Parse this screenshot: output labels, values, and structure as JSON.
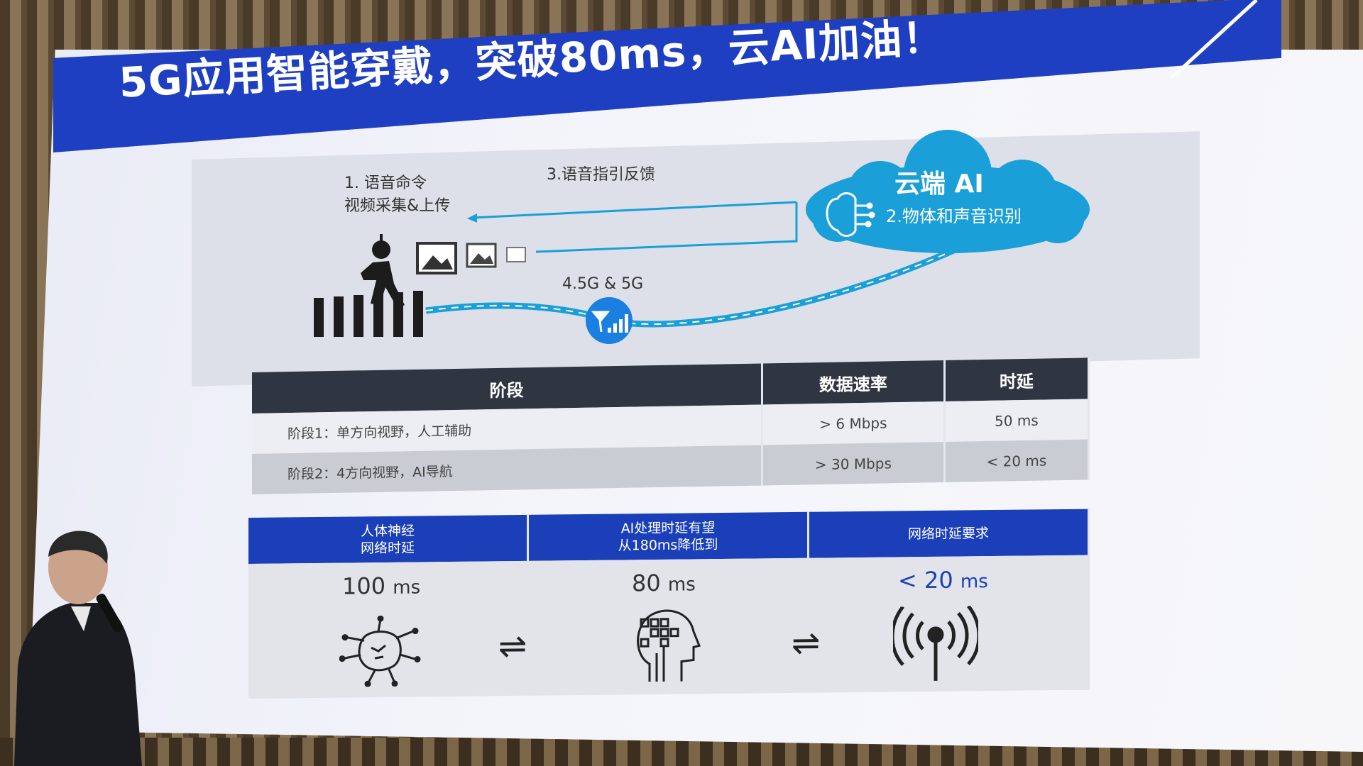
{
  "title": "5G应用智能穿戴，突破80ms，云AI加油！",
  "diagram": {
    "step1_line1": "1. 语音命令",
    "step1_line2": "视频采集&上传",
    "step3": "3.语音指引反馈",
    "network": "4.5G & 5G",
    "cloud_title": "云端 AI",
    "step2": "2.物体和声音识别"
  },
  "table": {
    "headers": [
      "阶段",
      "数据速率",
      "时延"
    ],
    "rows": [
      [
        "阶段1：单方向视野，人工辅助",
        "> 6 Mbps",
        "50 ms"
      ],
      [
        "阶段2：4方向视野，AI导航",
        "> 30 Mbps",
        "< 20 ms"
      ]
    ]
  },
  "latency": {
    "headers": [
      {
        "line1": "人体神经",
        "line2": "网络时延"
      },
      {
        "line1": "AI处理时延有望",
        "line2": "从180ms降低到"
      },
      {
        "line1": "网络时延要求",
        "line2": ""
      }
    ],
    "values": [
      {
        "num": "100",
        "unit": "ms"
      },
      {
        "num": "80",
        "unit": "ms"
      },
      {
        "num": "< 20",
        "unit": "ms"
      }
    ],
    "arrow_glyph": "⇌"
  },
  "icons": [
    "pedestrian-icon",
    "image-frame-icon",
    "signal-tower-icon",
    "cloud-icon",
    "brain-chip-icon",
    "neuron-icon",
    "ai-head-icon",
    "antenna-icon"
  ],
  "colors": {
    "banner": "#1f3fc3",
    "cloud": "#1a9fd8",
    "table_header": "#2f3642",
    "latency_header": "#1a3fb8"
  }
}
